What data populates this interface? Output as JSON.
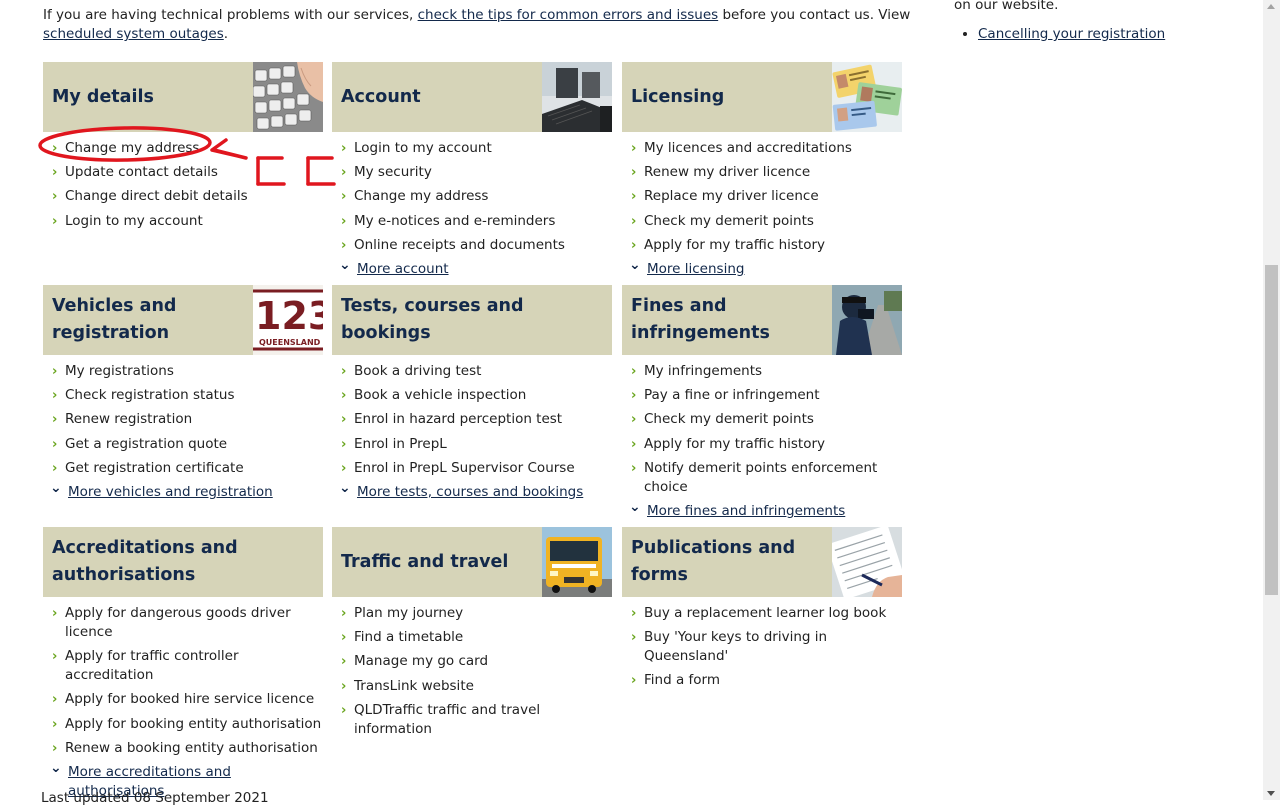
{
  "intro": {
    "text_before": "If you are having technical problems with our services, ",
    "tips_link": "check the tips for common errors and issues",
    "text_middle": " before you contact us. View ",
    "outages_link": "scheduled system outages",
    "text_after": "."
  },
  "sidebar": {
    "partial_text": "on our website.",
    "links": [
      "Cancelling your registration"
    ]
  },
  "tiles": [
    {
      "title": "My details",
      "image": "keyboard-image",
      "links": [
        "Change my address",
        "Update contact details",
        "Change direct debit details",
        "Login to my account"
      ],
      "more": ""
    },
    {
      "title": "Account",
      "image": "computer-image",
      "links": [
        "Login to my account",
        "My security",
        "Change my address",
        "My e-notices and e-reminders",
        "Online receipts and documents"
      ],
      "more": "More account"
    },
    {
      "title": "Licensing",
      "image": "licence-cards-image",
      "links": [
        "My licences and accreditations",
        "Renew my driver licence",
        "Replace my driver licence",
        "Check my demerit points",
        "Apply for my traffic history"
      ],
      "more": "More licensing"
    },
    {
      "title": "Vehicles and registration",
      "image": "number-plate-image",
      "image_text": "123",
      "image_subtext": "QUEENSLAND",
      "links": [
        "My registrations",
        "Check registration status",
        "Renew registration",
        "Get a registration quote",
        "Get registration certificate"
      ],
      "more": "More vehicles and registration"
    },
    {
      "title": "Tests, courses and bookings",
      "image": "",
      "links": [
        "Book a driving test",
        "Book a vehicle inspection",
        "Enrol in hazard perception test",
        "Enrol in PrepL",
        "Enrol in PrepL Supervisor Course"
      ],
      "more": "More tests, courses and bookings"
    },
    {
      "title": "Fines and infringements",
      "image": "police-camera-image",
      "links": [
        "My infringements",
        "Pay a fine or infringement",
        "Check my demerit points",
        "Apply for my traffic history",
        "Notify demerit points enforcement choice"
      ],
      "more": "More fines and infringements"
    },
    {
      "title": "Accreditations and authorisations",
      "image": "",
      "links": [
        "Apply for dangerous goods driver licence",
        "Apply for traffic controller accreditation",
        "Apply for booked hire service licence",
        "Apply for booking entity authorisation",
        "Renew a booking entity authorisation"
      ],
      "more": "More accreditations and authorisations"
    },
    {
      "title": "Traffic and travel",
      "image": "bus-image",
      "links": [
        "Plan my journey",
        "Find a timetable",
        "Manage my go card",
        "TransLink website",
        "QLDTraffic traffic and travel information"
      ],
      "more": ""
    },
    {
      "title": "Publications and forms",
      "image": "form-writing-image",
      "links": [
        "Buy a replacement learner log book",
        "Buy 'Your keys to driving in Queensland'",
        "Find a form"
      ],
      "more": ""
    }
  ],
  "footer": {
    "last_updated": "Last updated 08 September 2021"
  },
  "colors": {
    "tile_header_bg": "#d6d4b8",
    "title_color": "#13294b",
    "chevron_green": "#6aa51f",
    "annotation_red": "#e0161e"
  }
}
